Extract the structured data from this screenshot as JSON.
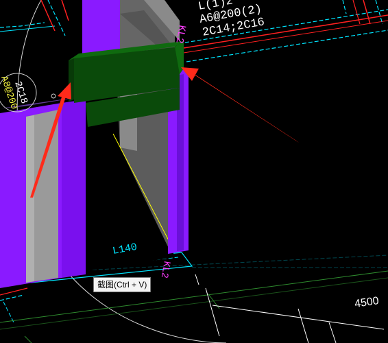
{
  "annotations": {
    "beam_code": "L(1)2",
    "stirrup": "A6@200(2)",
    "longitudinal_bars": "2C14;2C16",
    "beam_label_top": "KL2",
    "beam_label_bottom": "KL2",
    "left_circle_text_1": "2C18",
    "left_circle_text_2": "A8@200",
    "bottom_mark": "L140",
    "dimension": "4500"
  },
  "tooltip": {
    "text": "截图(Ctrl + V)"
  },
  "colors": {
    "background": "#000000",
    "beam": "#8a1aff",
    "beam_dark": "#6a10d8",
    "column_gray": "#8a8a8a",
    "column_shade": "#5c5c5c",
    "highlight_element": "#0a4a0a",
    "arrow": "#ff2a1a",
    "axis_cyan": "#00e5ff",
    "axis_red": "#ff2020",
    "dimension_green": "#2e8b2e",
    "text_white": "#ffffff",
    "text_magenta": "#ff3cff",
    "edge_yellow": "#ffff00"
  }
}
